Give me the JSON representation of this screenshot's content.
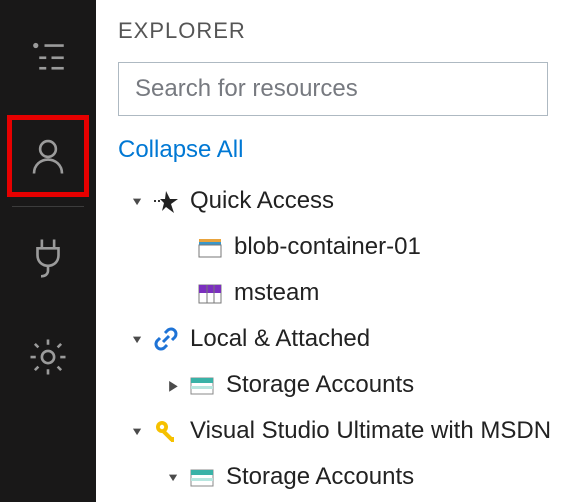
{
  "header": {
    "title": "EXPLORER"
  },
  "search": {
    "placeholder": "Search for resources",
    "value": ""
  },
  "actions": {
    "collapse": "Collapse All"
  },
  "sidebar": {
    "items": [
      {
        "name": "explorer-icon"
      },
      {
        "name": "account-icon"
      },
      {
        "name": "plug-icon"
      },
      {
        "name": "settings-icon"
      }
    ]
  },
  "tree": {
    "quick_access": {
      "label": "Quick Access",
      "children": [
        {
          "label": "blob-container-01",
          "icon": "container-icon"
        },
        {
          "label": "msteam",
          "icon": "table-icon"
        }
      ]
    },
    "local_attached": {
      "label": "Local & Attached",
      "children": [
        {
          "label": "Storage Accounts",
          "icon": "storage-icon"
        }
      ]
    },
    "subscription": {
      "label": "Visual Studio Ultimate with MSDN",
      "children": [
        {
          "label": "Storage Accounts",
          "icon": "storage-icon"
        }
      ]
    }
  }
}
